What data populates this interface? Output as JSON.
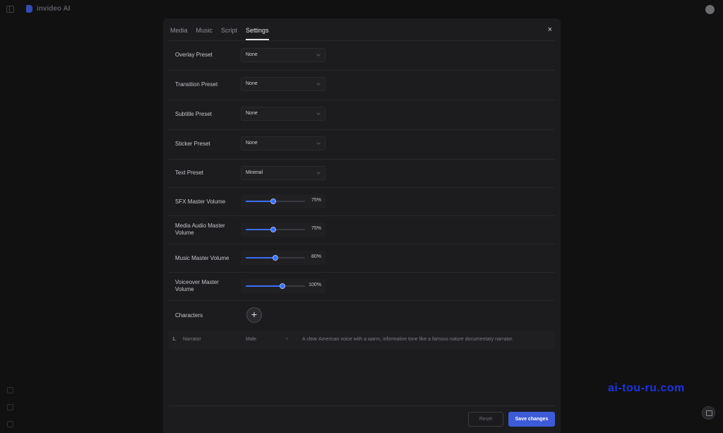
{
  "app": {
    "name": "invideo AI"
  },
  "tabs": [
    {
      "label": "Media"
    },
    {
      "label": "Music"
    },
    {
      "label": "Script"
    },
    {
      "label": "Settings",
      "active": true
    }
  ],
  "close_label": "×",
  "settings": {
    "overlay": {
      "label": "Overlay Preset",
      "value": "None"
    },
    "transition": {
      "label": "Transition Preset",
      "value": "None"
    },
    "subtitle": {
      "label": "Subtitle Preset",
      "value": "None"
    },
    "sticker": {
      "label": "Sticker Preset",
      "value": "None"
    },
    "text": {
      "label": "Text Preset",
      "value": "Minimal"
    },
    "sfx": {
      "label": "SFX Master Volume",
      "value": 0.75,
      "display": "75%"
    },
    "media_audio": {
      "label": "Media Audio Master Volume",
      "value": 0.75,
      "display": "75%"
    },
    "music": {
      "label": "Music Master Volume",
      "value": 0.8,
      "display": "80%"
    },
    "voiceover": {
      "label": "Voiceover Master Volume",
      "value": 1.0,
      "display": "100%"
    }
  },
  "characters": {
    "label": "Characters",
    "add_label": "+",
    "items": [
      {
        "index": "1.",
        "name": "Narrator",
        "voice": "Male",
        "description": "A clear American voice with a warm, informative tone like a famous nature documentary narrator."
      }
    ]
  },
  "footer": {
    "reset_label": "Reset",
    "save_label": "Save changes"
  },
  "watermark": "ai-tou-ru.com",
  "colors": {
    "accent": "#3d5bd9",
    "slider": "#3b6ff5",
    "background": "#111112",
    "modal": "#1c1c1f"
  }
}
